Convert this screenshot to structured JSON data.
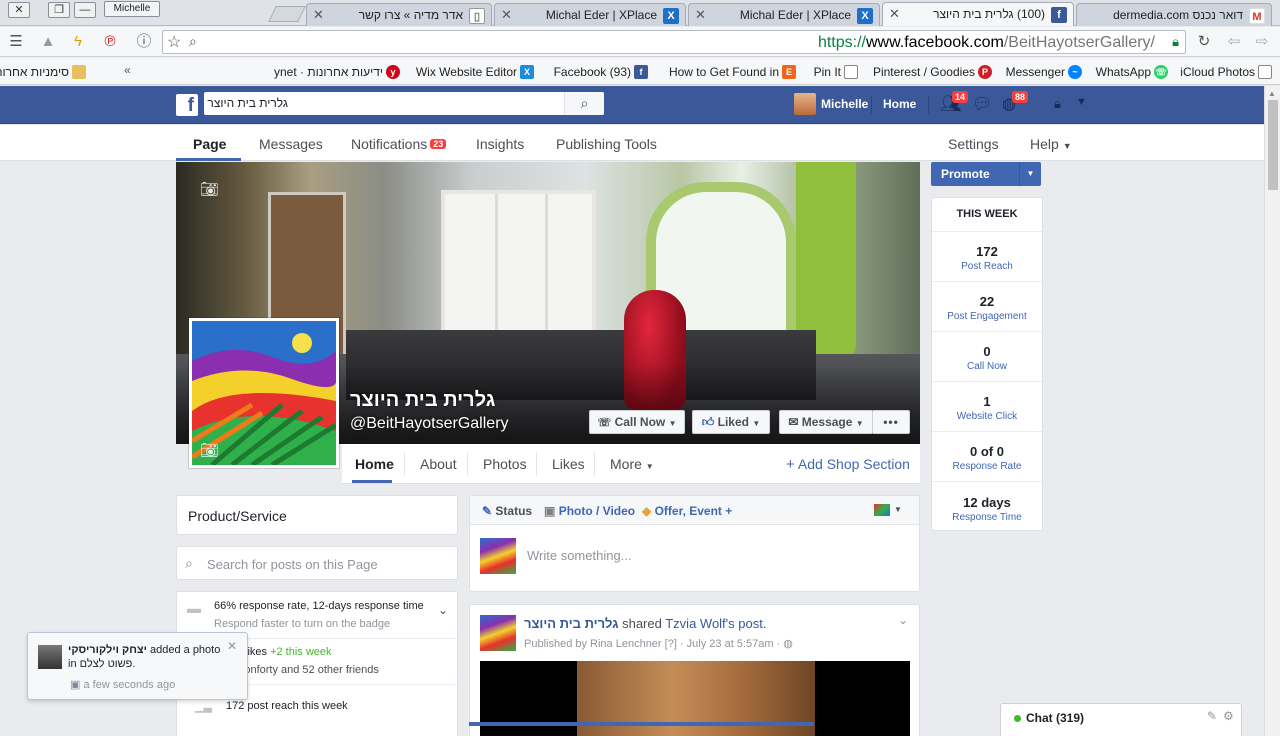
{
  "window": {
    "profile": "Michelle"
  },
  "tabs": [
    {
      "title": "אדר מדיה » צרו קשר",
      "favicon": "doc-icon"
    },
    {
      "title": "Michal Eder | XPlace",
      "favicon": "xplace-icon"
    },
    {
      "title": "Michal Eder | XPlace",
      "favicon": "xplace-icon"
    },
    {
      "title": "(100) גלרית בית היוצר",
      "favicon": "facebook-icon",
      "active": true
    },
    {
      "title": "דואר נכנס dermedia.com",
      "favicon": "gmail-icon"
    }
  ],
  "address": {
    "scheme": "https://",
    "domain": "www.facebook.com",
    "path": "/BeitHayotserGallery/"
  },
  "bookmarks": [
    {
      "label": "סימניות אחרות",
      "icon": "folder-icon"
    },
    {
      "label": "ידיעות אחרונות · ynet",
      "icon": "ynet-icon"
    },
    {
      "label": "Wix Website Editor",
      "icon": "wix-icon"
    },
    {
      "label": "(93) Facebook",
      "icon": "facebook-icon"
    },
    {
      "label": "How to Get Found in",
      "icon": "etsy-icon"
    },
    {
      "label": "Pin It",
      "icon": "doc-icon"
    },
    {
      "label": "Pinterest / Goodies",
      "icon": "pinterest-icon"
    },
    {
      "label": "Messenger",
      "icon": "messenger-icon"
    },
    {
      "label": "WhatsApp",
      "icon": "whatsapp-icon"
    },
    {
      "label": "iCloud Photos",
      "icon": "doc-icon"
    }
  ],
  "fb": {
    "search_value": "גלרית בית היוצר",
    "user": "Michelle",
    "home": "Home",
    "friend_badge": "14",
    "notif_badge": "88"
  },
  "page_nav": {
    "page": "Page",
    "messages": "Messages",
    "notifications": "Notifications",
    "notifications_count": "23",
    "insights": "Insights",
    "publishing": "Publishing Tools",
    "settings": "Settings",
    "help": "Help"
  },
  "profile": {
    "name": "גלרית בית היוצר",
    "handle": "@BeitHayotserGallery",
    "call_now": "Call Now",
    "liked": "Liked",
    "message": "Message",
    "more_dots": "•••"
  },
  "sub_nav": {
    "home": "Home",
    "about": "About",
    "photos": "Photos",
    "likes": "Likes",
    "more": "More",
    "add_shop": "Add Shop Section"
  },
  "promote": "Promote",
  "this_week": {
    "title": "THIS WEEK",
    "stats": [
      {
        "value": "172",
        "label": "Post Reach"
      },
      {
        "value": "22",
        "label": "Post Engagement"
      },
      {
        "value": "0",
        "label": "Call Now"
      },
      {
        "value": "1",
        "label": "Website Click"
      },
      {
        "value": "0 of 0",
        "label": "Response Rate"
      },
      {
        "value": "12 days",
        "label": "Response Time"
      }
    ]
  },
  "left": {
    "category": "Product/Service",
    "search_placeholder": "Search for posts on this Page",
    "response_line": "66% response rate, 12-days response time",
    "response_hint": "Respond faster to turn on the badge",
    "likes_word": "likes",
    "likes_week": "+2 this week",
    "likes_friends": "Konforty and 52 other friends",
    "reach": "172 post reach this week"
  },
  "composer": {
    "status": "Status",
    "photo": "Photo / Video",
    "offer": "Offer, Event +",
    "placeholder": "Write something..."
  },
  "post": {
    "page": "גלרית בית היוצר",
    "shared": "shared",
    "author": "Tzvia Wolf's",
    "object": "post.",
    "published": "Published by Rina Lenchner",
    "unknown": "[?]",
    "date": "· July 23 at 5:57am ·"
  },
  "toast": {
    "user": "יצחק וילקוריסקי",
    "action": "added a photo",
    "in_word": "in",
    "album": "פשוט לצלם.",
    "time": "a few seconds ago"
  },
  "chat": {
    "label": "Chat (319)"
  },
  "colors": {
    "fb_blue": "#3b5998",
    "link": "#4267b2",
    "badge": "#fa3e3e",
    "online": "#42b72a"
  }
}
